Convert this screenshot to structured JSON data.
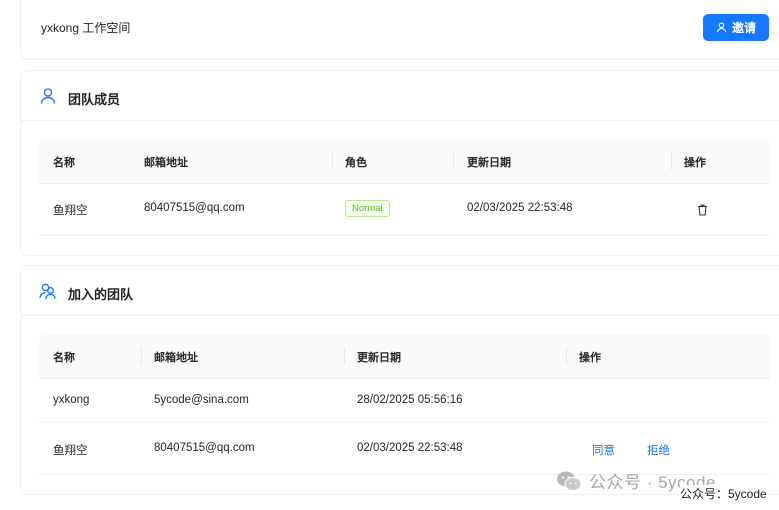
{
  "header": {
    "workspace_title": "yxkong 工作空间",
    "invite_label": "邀请"
  },
  "team": {
    "title": "团队成员",
    "columns": [
      "名称",
      "邮箱地址",
      "角色",
      "更新日期",
      "操作"
    ],
    "rows": [
      {
        "name": "鱼翔空",
        "email": "80407515@qq.com",
        "role": "Normal",
        "updated": "02/03/2025 22:53:48"
      }
    ]
  },
  "joined": {
    "title": "加入的团队",
    "columns": [
      "名称",
      "邮箱地址",
      "更新日期",
      "操作"
    ],
    "rows": [
      {
        "name": "yxkong",
        "email": "5ycode@sina.com",
        "updated": "28/02/2025 05:56:16"
      },
      {
        "name": "鱼翔空",
        "email": "80407515@qq.com",
        "updated": "02/03/2025 22:53:48",
        "accept": "同意",
        "reject": "拒绝"
      }
    ]
  },
  "watermark": {
    "text": "公众号 · 5ycode",
    "caption": "公众号：5ycode"
  },
  "colors": {
    "accent": "#1677ff",
    "tag_green": "#52c41a"
  }
}
